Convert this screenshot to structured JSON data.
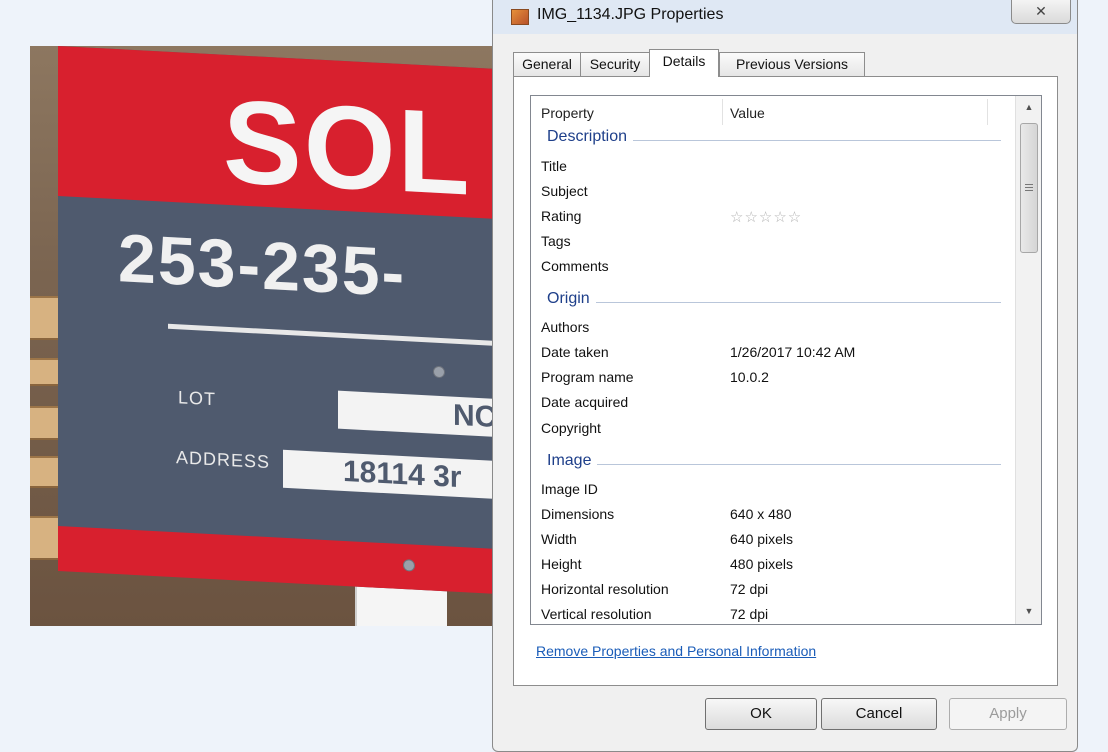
{
  "window": {
    "title": "IMG_1134.JPG Properties",
    "close_glyph": "✕"
  },
  "photo": {
    "sign_top": "SOL",
    "sign_phone": "253-235-",
    "lot_label": "LOT",
    "lot_value": "NC",
    "address_label": "ADDRESS",
    "address_value": "18114 3r"
  },
  "tabs": [
    {
      "label": "General"
    },
    {
      "label": "Security"
    },
    {
      "label": "Details",
      "active": true
    },
    {
      "label": "Previous Versions"
    }
  ],
  "details": {
    "columns": {
      "property": "Property",
      "value": "Value"
    },
    "groups": {
      "description": "Description",
      "origin": "Origin",
      "image": "Image"
    },
    "rows": {
      "title": {
        "k": "Title",
        "v": ""
      },
      "subject": {
        "k": "Subject",
        "v": ""
      },
      "rating": {
        "k": "Rating",
        "v": "☆☆☆☆☆"
      },
      "tags": {
        "k": "Tags",
        "v": ""
      },
      "comments": {
        "k": "Comments",
        "v": ""
      },
      "authors": {
        "k": "Authors",
        "v": ""
      },
      "date_taken": {
        "k": "Date taken",
        "v": "1/26/2017 10:42 AM"
      },
      "program_name": {
        "k": "Program name",
        "v": "10.0.2"
      },
      "date_acquired": {
        "k": "Date acquired",
        "v": ""
      },
      "copyright": {
        "k": "Copyright",
        "v": ""
      },
      "image_id": {
        "k": "Image ID",
        "v": ""
      },
      "dimensions": {
        "k": "Dimensions",
        "v": "640 x 480"
      },
      "width": {
        "k": "Width",
        "v": "640 pixels"
      },
      "height": {
        "k": "Height",
        "v": "480 pixels"
      },
      "hres": {
        "k": "Horizontal resolution",
        "v": "72 dpi"
      },
      "vres": {
        "k": "Vertical resolution",
        "v": "72 dpi"
      }
    },
    "remove_link": "Remove Properties and Personal Information"
  },
  "buttons": {
    "ok": "OK",
    "cancel": "Cancel",
    "apply": "Apply"
  },
  "colors": {
    "link": "#1a5cb8",
    "group_header": "#1e3f8a",
    "sign_red": "#d8202e",
    "sign_gray": "#4f5a6e"
  }
}
